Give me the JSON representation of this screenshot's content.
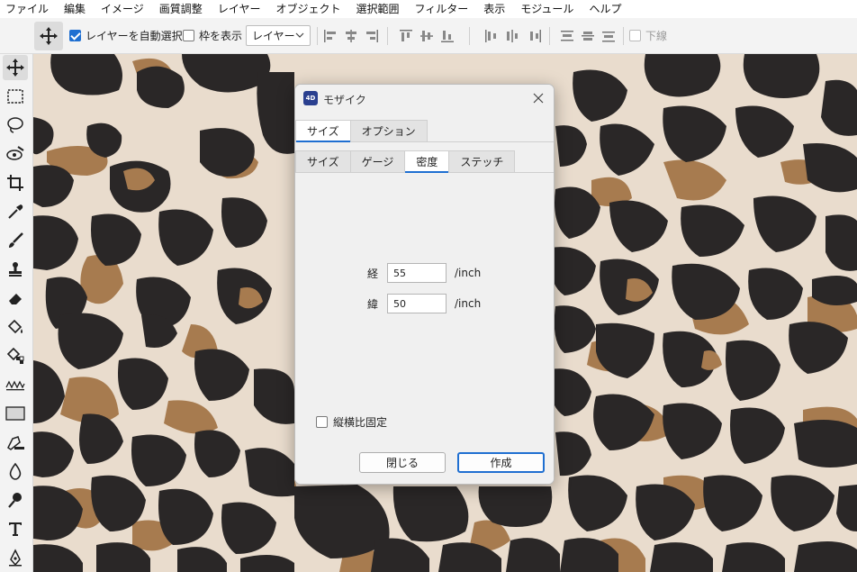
{
  "menubar": {
    "items": [
      "ファイル",
      "編集",
      "イメージ",
      "画質調整",
      "レイヤー",
      "オブジェクト",
      "選択範囲",
      "フィルター",
      "表示",
      "モジュール",
      "ヘルプ"
    ]
  },
  "optionsbar": {
    "auto_select_label": "レイヤーを自動選択",
    "auto_select_checked": true,
    "show_bounds_label": "枠を表示",
    "show_bounds_checked": false,
    "target_select_value": "レイヤー",
    "underline_label": "下線",
    "underline_checked": false
  },
  "toolbox": {
    "tools": [
      "move-icon",
      "marquee-icon",
      "lasso-icon",
      "magic-wand-icon",
      "crop-icon",
      "eyedropper-icon",
      "brush-icon",
      "stamp-icon",
      "eraser-icon",
      "bucket-icon",
      "gradient-fill-icon",
      "wave-icon",
      "rectangle-icon",
      "pen-icon",
      "drop-icon",
      "dodge-icon",
      "type-icon",
      "path-icon"
    ]
  },
  "canvas": {
    "colors": {
      "background": "#e9dccd",
      "spot": "#2a2727",
      "accent": "#a77b4f"
    }
  },
  "dialog": {
    "app_icon_text": "4D",
    "title": "モザイク",
    "outer_tabs": [
      {
        "label": "サイズ",
        "selected": true
      },
      {
        "label": "オプション",
        "selected": false
      }
    ],
    "inner_tabs": [
      {
        "label": "サイズ",
        "selected": false
      },
      {
        "label": "ゲージ",
        "selected": false
      },
      {
        "label": "密度",
        "selected": true
      },
      {
        "label": "ステッチ",
        "selected": false
      }
    ],
    "vertical": {
      "label": "経",
      "value": "55",
      "unit": "/inch"
    },
    "horizontal": {
      "label": "緯",
      "value": "50",
      "unit": "/inch"
    },
    "aspect_lock": {
      "label": "縦横比固定",
      "checked": false
    },
    "close_button": "閉じる",
    "create_button": "作成"
  }
}
